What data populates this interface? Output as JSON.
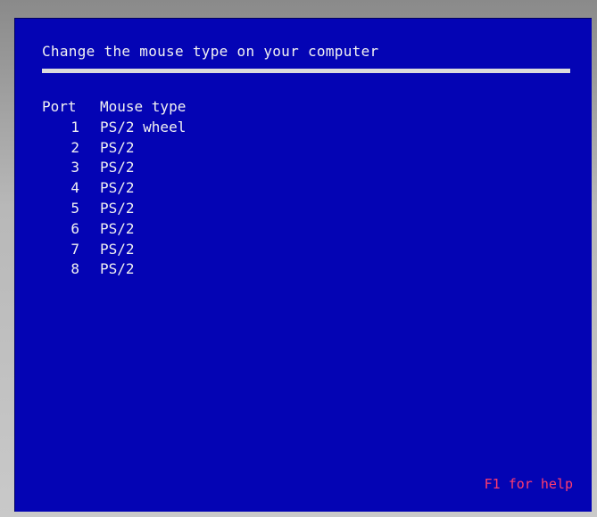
{
  "screen": {
    "title": "Change the mouse type on your computer",
    "table": {
      "headers": {
        "port": "Port",
        "type": "Mouse type"
      },
      "rows": [
        {
          "port": "1",
          "type": "PS/2 wheel"
        },
        {
          "port": "2",
          "type": "PS/2"
        },
        {
          "port": "3",
          "type": "PS/2"
        },
        {
          "port": "4",
          "type": "PS/2"
        },
        {
          "port": "5",
          "type": "PS/2"
        },
        {
          "port": "6",
          "type": "PS/2"
        },
        {
          "port": "7",
          "type": "PS/2"
        },
        {
          "port": "8",
          "type": "PS/2"
        }
      ]
    },
    "help_hint": "F1 for help"
  },
  "colors": {
    "background": "#0404b4",
    "text": "#f2f2f2",
    "rule": "#dcdcdc",
    "help": "#ff3c6e"
  }
}
